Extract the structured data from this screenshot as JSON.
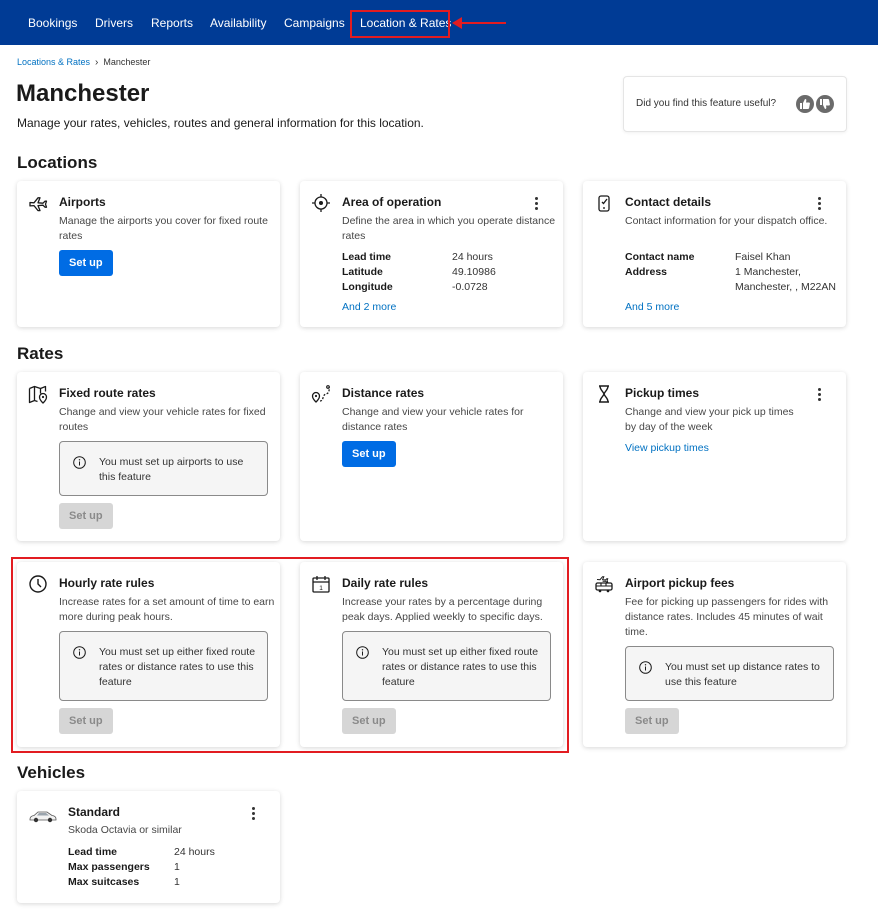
{
  "nav": {
    "items": [
      "Bookings",
      "Drivers",
      "Reports",
      "Availability",
      "Campaigns",
      "Location & Rates"
    ],
    "active": "Location & Rates"
  },
  "breadcrumb": {
    "parent": "Locations & Rates",
    "current": "Manchester"
  },
  "header": {
    "title": "Manchester",
    "subtitle": "Manage your rates, vehicles, routes and general information for this location."
  },
  "feedback": {
    "question": "Did you find this feature useful?"
  },
  "sections": {
    "locations": "Locations",
    "rates": "Rates",
    "vehicles": "Vehicles"
  },
  "cards": {
    "airports": {
      "title": "Airports",
      "desc": "Manage the airports you cover for fixed route rates",
      "button": "Set up"
    },
    "area": {
      "title": "Area of operation",
      "desc": "Define the area in which you operate distance rates",
      "rows": [
        {
          "k": "Lead time",
          "v": "24 hours"
        },
        {
          "k": "Latitude",
          "v": "49.10986"
        },
        {
          "k": "Longitude",
          "v": "-0.0728"
        }
      ],
      "more": "And 2 more"
    },
    "contact": {
      "title": "Contact details",
      "desc": "Contact information for your dispatch office.",
      "name_k": "Contact name",
      "name_v": "Faisel Khan",
      "addr_k": "Address",
      "addr_v1": "1 Manchester,",
      "addr_v2": "Manchester, , M22AN",
      "more": "And 5 more"
    },
    "fixed": {
      "title": "Fixed route rates",
      "desc": "Change and view your vehicle rates for fixed routes",
      "info": "You must set up airports to use this feature",
      "button": "Set up"
    },
    "distance": {
      "title": "Distance rates",
      "desc": "Change and view your vehicle rates for distance rates",
      "button": "Set up"
    },
    "pickup": {
      "title": "Pickup times",
      "desc": "Change and view your pick up times by day of the week",
      "link": "View pickup times"
    },
    "hourly": {
      "title": "Hourly rate rules",
      "desc": "Increase rates for a set amount of time to earn more during peak hours.",
      "info": "You must set up either fixed route rates or distance rates to use this feature",
      "button": "Set up"
    },
    "daily": {
      "title": "Daily rate rules",
      "desc": "Increase your rates by a percentage during peak days. Applied weekly to specific days.",
      "info": "You must set up either fixed route rates or distance rates to use this feature",
      "button": "Set up"
    },
    "airportfees": {
      "title": "Airport pickup fees",
      "desc": "Fee for picking up passengers for rides with distance rates. Includes 45 minutes of wait time.",
      "info": "You must set up distance rates to use this feature",
      "button": "Set up"
    },
    "vehicle": {
      "title": "Standard",
      "desc": "Skoda Octavia or similar",
      "rows": [
        {
          "k": "Lead time",
          "v": "24 hours"
        },
        {
          "k": "Max passengers",
          "v": "1"
        },
        {
          "k": "Max suitcases",
          "v": "1"
        }
      ]
    }
  },
  "colors": {
    "nav_bg": "#003b95",
    "primary": "#006ce4",
    "link": "#0071c2",
    "highlight": "#e21c21"
  },
  "icons": [
    "airplane-icon",
    "target-icon",
    "contact-device-icon",
    "map-pin-icon",
    "route-pin-icon",
    "hourglass-icon",
    "clock-icon",
    "calendar-icon",
    "bus-icon",
    "car-icon",
    "info-icon",
    "kebab-icon",
    "thumbs-up-icon",
    "thumbs-down-icon"
  ]
}
